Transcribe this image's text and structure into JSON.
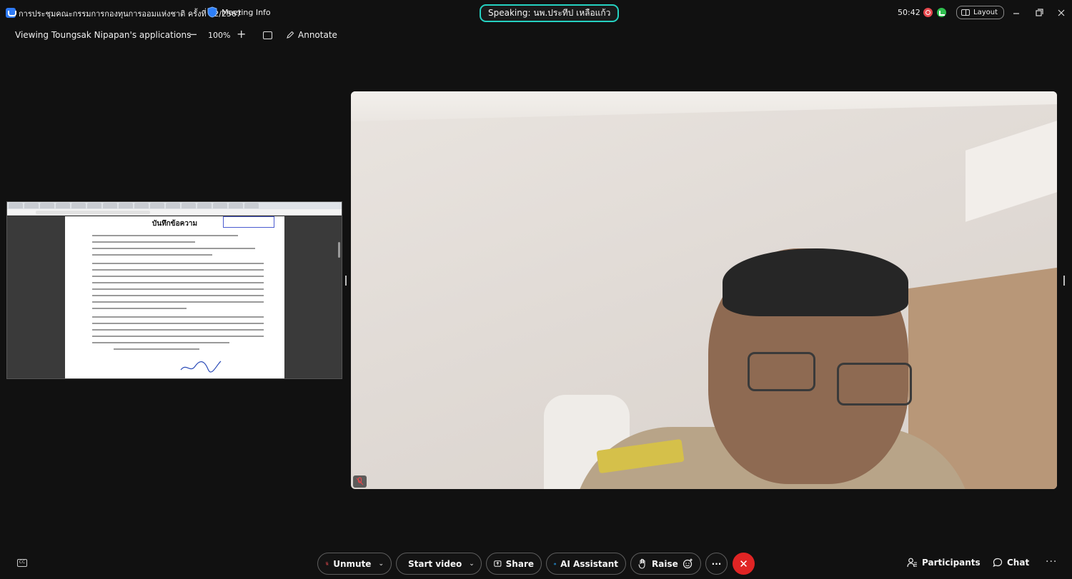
{
  "titlebar": {
    "meeting_title": "การประชุมคณะกรรมการกองทุนการออมแห่งชาติ ครั้งที่ 12/2567",
    "meeting_info_label": "Meeting Info",
    "speaking_label": "Speaking: นพ.ประทีป เหลือแก้ว",
    "timer": "50:42",
    "layout_label": "Layout"
  },
  "share_bar": {
    "viewing_label": "Viewing Toungsak Nipapan's applications",
    "zoom_level": "100%",
    "annotate_label": "Annotate"
  },
  "shared_document": {
    "title": "บันทึกข้อความ"
  },
  "controls": {
    "unmute_label": "Unmute",
    "start_video_label": "Start video",
    "share_label": "Share",
    "ai_assistant_label": "AI Assistant",
    "raise_label": "Raise",
    "more_label": "···",
    "participants_label": "Participants",
    "chat_label": "Chat"
  },
  "colors": {
    "speaking_border": "#25d1c1",
    "end_call": "#e02424",
    "recording": "#e5484d",
    "connection": "#2fbf4f",
    "muted_icon": "#e5484d"
  },
  "icons": [
    "webex-logo-icon",
    "shield-icon",
    "record-icon",
    "signal-icon",
    "layout-icon",
    "minimize-icon",
    "restore-icon",
    "close-icon",
    "zoom-out-icon",
    "zoom-in-icon",
    "fit-screen-icon",
    "annotate-pen-icon",
    "captions-icon",
    "mic-muted-icon",
    "video-off-icon",
    "share-icon",
    "ai-assistant-icon",
    "raise-hand-icon",
    "reaction-icon",
    "more-icon",
    "end-call-icon",
    "participants-icon",
    "chat-icon"
  ]
}
